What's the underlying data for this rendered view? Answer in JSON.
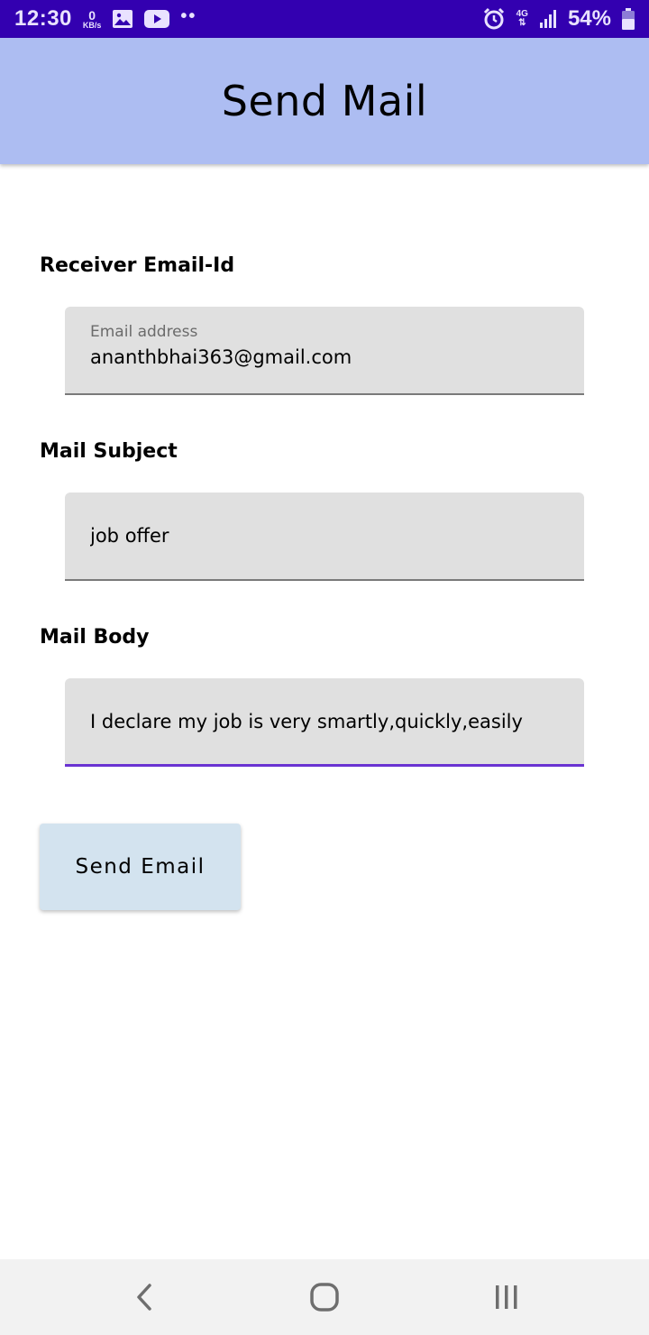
{
  "status_bar": {
    "time": "12:30",
    "net_speed": "0",
    "net_unit": "KB/s",
    "dots": "••",
    "network_type": "4G",
    "battery": "54%"
  },
  "app_bar": {
    "title": "Send Mail"
  },
  "form": {
    "receiver": {
      "label": "Receiver Email-Id",
      "placeholder": "Email address",
      "value": "ananthbhai363@gmail.com"
    },
    "subject": {
      "label": "Mail Subject",
      "value": "job offer"
    },
    "body": {
      "label": "Mail Body",
      "value": "I declare my job is very smartly,quickly,easily"
    },
    "send_button_label": "Send Email"
  },
  "colors": {
    "status_bar": "#3300b0",
    "app_bar": "#adbdf2",
    "field_bg": "#e0e0e0",
    "focus_accent": "#6a33d2",
    "button_bg": "#d3e3ef"
  },
  "icons": {
    "status": [
      "image-icon",
      "youtube-icon",
      "alarm-icon",
      "signal-icon",
      "battery-icon"
    ],
    "nav": [
      "back-icon",
      "home-icon",
      "recents-icon"
    ]
  }
}
